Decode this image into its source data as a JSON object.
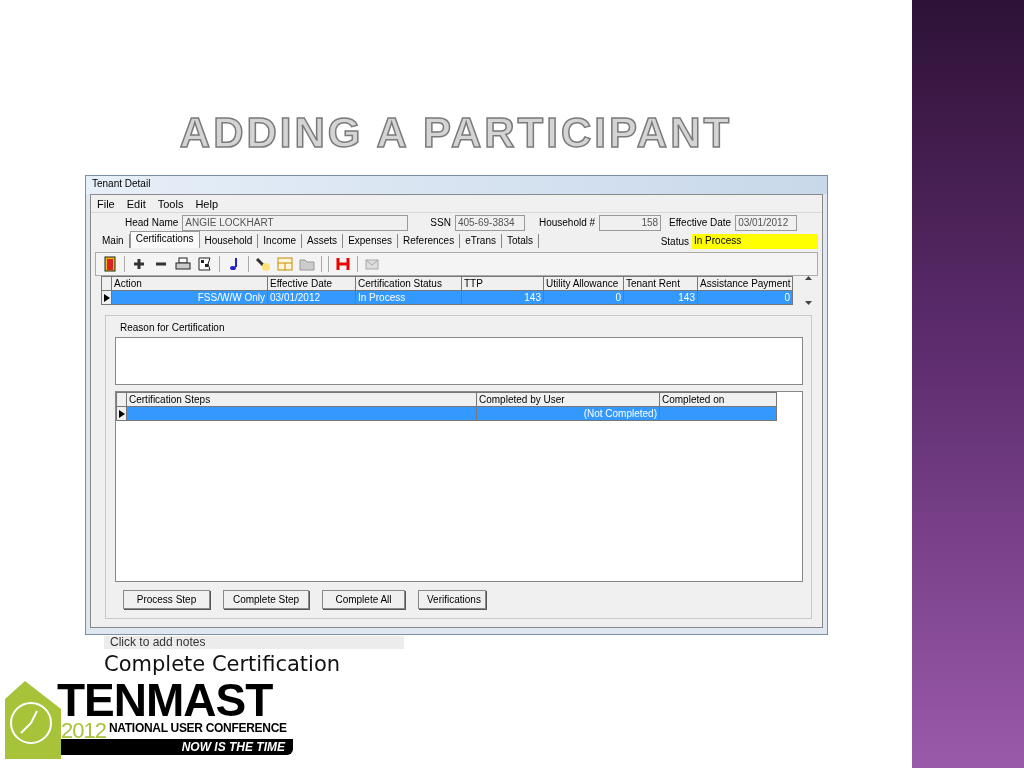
{
  "slide": {
    "title": "ADDING A PARTICIPANT",
    "caption": "Complete Certification",
    "notes_placeholder": "Click to add notes"
  },
  "window": {
    "title": "Tenant Detail",
    "menu": [
      "File",
      "Edit",
      "Tools",
      "Help"
    ],
    "header_fields": [
      {
        "label": "Head Name",
        "value": "ANGIE LOCKHART"
      },
      {
        "label": "SSN",
        "value": "405-69-3834"
      },
      {
        "label": "Household #",
        "value": "158"
      },
      {
        "label": "Effective Date",
        "value": "03/01/2012"
      }
    ],
    "tabs": [
      {
        "label": "Main",
        "selected": false
      },
      {
        "label": "Certifications",
        "selected": true
      },
      {
        "label": "Household",
        "selected": false
      },
      {
        "label": "Income",
        "selected": false
      },
      {
        "label": "Assets",
        "selected": false
      },
      {
        "label": "Expenses",
        "selected": false
      },
      {
        "label": "References",
        "selected": false
      },
      {
        "label": "eTrans",
        "selected": false
      },
      {
        "label": "Totals",
        "selected": false
      }
    ],
    "status": {
      "label": "Status",
      "value": "In Process"
    },
    "certifications": {
      "columns": [
        "Action",
        "Effective Date",
        "Certification Status",
        "TTP",
        "Utility Allowance",
        "Tenant Rent",
        "Assistance Payment"
      ],
      "rows": [
        {
          "cells": [
            "FSS/W/W Only",
            "03/01/2012",
            "In Process",
            "143",
            "0",
            "143",
            "0"
          ],
          "selected": true
        }
      ]
    },
    "reason_label": "Reason for Certification",
    "steps": {
      "columns": [
        "Certification Steps",
        "Completed by User",
        "Completed on"
      ],
      "rows": [
        {
          "cells": [
            null,
            "(Not Completed)",
            null
          ],
          "selected": true
        }
      ]
    },
    "buttons": [
      "Process Step",
      "Complete Step",
      "Complete All",
      "Verifications"
    ]
  },
  "logo": {
    "name": "TENMAST",
    "year": "2012",
    "subtitle": "NATIONAL USER CONFERENCE",
    "tagline": "NOW IS THE TIME"
  }
}
